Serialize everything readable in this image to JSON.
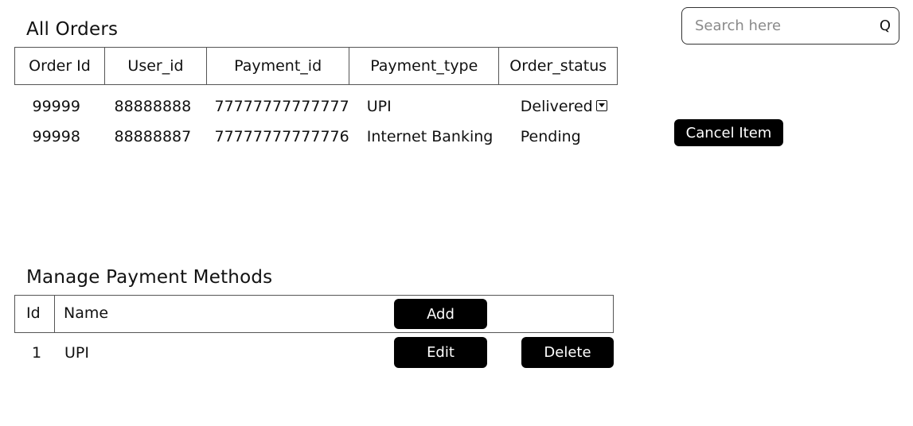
{
  "orders_section": {
    "title": "All Orders",
    "columns": [
      "Order Id",
      "User_id",
      "Payment_id",
      "Payment_type",
      "Order_status"
    ],
    "rows": [
      {
        "order_id": "99999",
        "user_id": "88888888",
        "payment_id": "77777777777777",
        "payment_type": "UPI",
        "order_status": "Delivered",
        "status_control": "dropdown-icon"
      },
      {
        "order_id": "99998",
        "user_id": "88888887",
        "payment_id": "77777777777776",
        "payment_type": "Internet Banking",
        "order_status": "Pending",
        "action_label": "Cancel Item"
      }
    ]
  },
  "search": {
    "placeholder": "Search here",
    "value": "",
    "icon": "search-icon"
  },
  "payment_methods_section": {
    "title": "Manage Payment Methods",
    "columns": [
      "Id",
      "Name"
    ],
    "add_label": "Add",
    "rows": [
      {
        "id": "1",
        "name": "UPI",
        "edit_label": "Edit",
        "delete_label": "Delete"
      }
    ]
  },
  "colors": {
    "button_bg": "#000000",
    "button_text": "#ffffff",
    "border": "#555555",
    "placeholder": "#8a8a8a"
  }
}
